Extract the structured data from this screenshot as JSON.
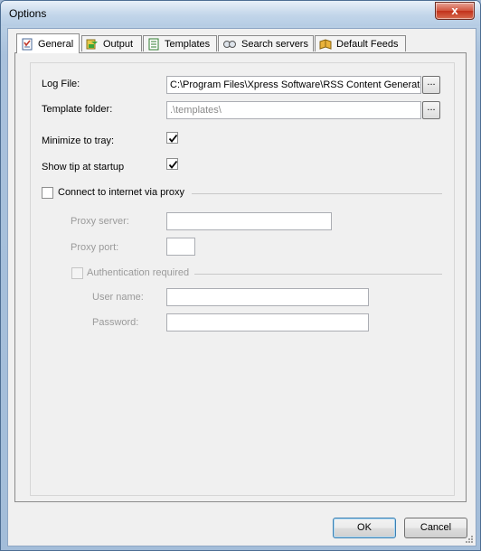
{
  "window": {
    "title": "Options",
    "close_glyph": "x"
  },
  "tabs": [
    {
      "label": "General",
      "icon": "checklist-icon",
      "active": true
    },
    {
      "label": "Output",
      "icon": "output-icon",
      "active": false
    },
    {
      "label": "Templates",
      "icon": "templates-icon",
      "active": false
    },
    {
      "label": "Search servers",
      "icon": "search-servers-icon",
      "active": false
    },
    {
      "label": "Default Feeds",
      "icon": "feeds-icon",
      "active": false
    }
  ],
  "general": {
    "log_file_label": "Log File:",
    "log_file_value": "C:\\Program Files\\Xpress Software\\RSS Content Generato",
    "template_folder_label": "Template folder:",
    "template_folder_value": ".\\templates\\",
    "browse_label": "...",
    "minimize_tray_label": "Minimize to tray:",
    "minimize_tray_checked": true,
    "show_tip_label": "Show tip at startup",
    "show_tip_checked": true
  },
  "proxy": {
    "connect_label": "Connect to internet via proxy",
    "connect_checked": false,
    "server_label": "Proxy server:",
    "server_value": "",
    "port_label": "Proxy port:",
    "port_value": "",
    "auth_label": "Authentication required",
    "auth_checked": false,
    "user_label": "User name:",
    "user_value": "",
    "password_label": "Password:",
    "password_value": ""
  },
  "buttons": {
    "ok": "OK",
    "cancel": "Cancel"
  }
}
